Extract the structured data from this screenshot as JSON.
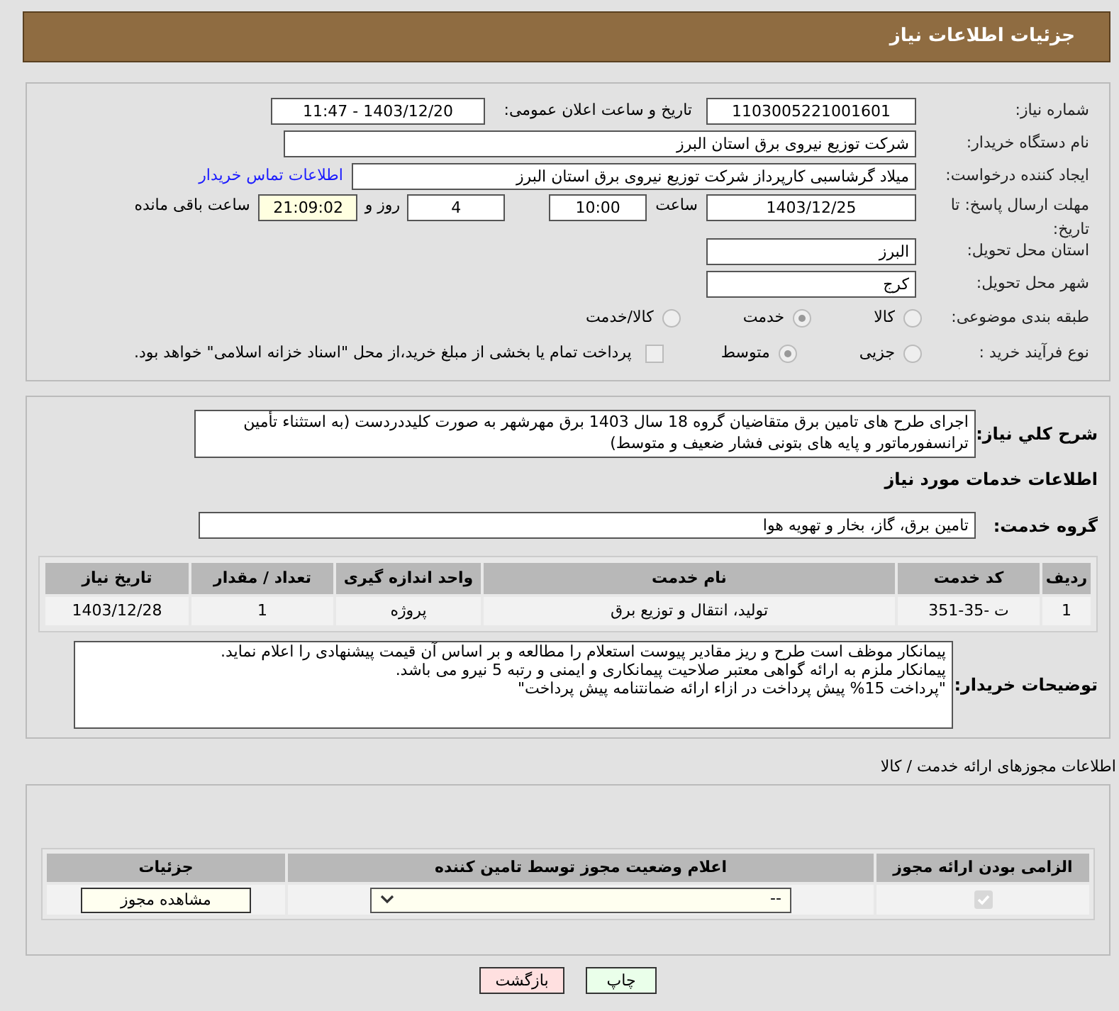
{
  "header": {
    "title": "جزئیات اطلاعات نیاز"
  },
  "need_number": {
    "label": "شماره نیاز:",
    "value": "1103005221001601"
  },
  "announce": {
    "label": "تاریخ و ساعت اعلان عمومی:",
    "value": "1403/12/20 - 11:47"
  },
  "buyer": {
    "label": "نام دستگاه خریدار:",
    "value": "شرکت توزیع نیروی برق استان البرز"
  },
  "requester": {
    "label": "ایجاد کننده درخواست:",
    "value": "میلاد گرشاسبی کارپرداز شرکت توزیع نیروی برق استان البرز",
    "link": "اطلاعات تماس خریدار"
  },
  "deadline": {
    "label": "مهلت ارسال پاسخ: تا تاریخ:",
    "date": "1403/12/25",
    "time_label": "ساعت",
    "time": "10:00",
    "days": "4",
    "days_label": "روز و",
    "remaining": "21:09:02",
    "remaining_label": "ساعت باقی مانده"
  },
  "province": {
    "label": "استان محل تحویل:",
    "value": "البرز"
  },
  "city": {
    "label": "شهر محل تحویل:",
    "value": "کرج"
  },
  "category": {
    "label": "طبقه بندی موضوعی:",
    "options": [
      {
        "label": "کالا",
        "selected": false
      },
      {
        "label": "خدمت",
        "selected": true
      },
      {
        "label": "کالا/خدمت",
        "selected": false
      }
    ]
  },
  "process": {
    "label": "نوع فرآیند خرید :",
    "options": [
      {
        "label": "جزیی",
        "selected": false
      },
      {
        "label": "متوسط",
        "selected": true
      }
    ],
    "treasury": {
      "checked": false,
      "label": "پرداخت تمام یا بخشی از مبلغ خرید،از محل \"اسناد خزانه اسلامی\" خواهد بود."
    }
  },
  "description": {
    "label": "شرح کلي نياز:",
    "value": "اجرای طرح های تامین برق متقاضیان گروه 18  سال 1403 برق مهرشهر به صورت کلیددردست (به استثناء تأمین ترانسفورماتور و پایه های بتونی فشار ضعیف و متوسط)"
  },
  "services_title": "اطلاعات خدمات مورد نیاز",
  "service_group": {
    "label": "گروه خدمت:",
    "value": "تامین برق، گاز، بخار و تهویه هوا"
  },
  "services_table": {
    "columns": [
      "ردیف",
      "کد خدمت",
      "نام خدمت",
      "واحد اندازه گیری",
      "تعداد / مقدار",
      "تاریخ نیاز"
    ],
    "rows": [
      [
        "1",
        "ت -35-351",
        "تولید، انتقال و توزیع برق",
        "پروژه",
        "1",
        "1403/12/28"
      ]
    ]
  },
  "buyer_notes": {
    "label": "توضیحات خریدار:",
    "lines": [
      "پیمانکار موظف است طرح و ریز مقادیر پیوست استعلام را مطالعه و بر اساس آن قیمت پیشنهادی را اعلام نماید.",
      "پیمانکار ملزم به ارائه گواهی معتبر صلاحیت پیمانکاری و ایمنی و رتبه 5 نیرو می باشد.",
      "\"پرداخت 15% پیش پرداخت در ازاء ارائه ضمانتنامه پیش پرداخت\""
    ]
  },
  "permits_title": "اطلاعات مجوزهای ارائه خدمت / کالا",
  "permits_table": {
    "columns": [
      "الزامی بودن ارائه مجوز",
      "اعلام وضعیت مجوز توسط تامین کننده",
      "جزئیات"
    ],
    "rows": [
      {
        "required": true,
        "status": "--",
        "details_button": "مشاهده مجوز"
      }
    ]
  },
  "buttons": [
    {
      "label": "چاپ",
      "kind": "print"
    },
    {
      "label": "بازگشت",
      "kind": "back"
    }
  ]
}
